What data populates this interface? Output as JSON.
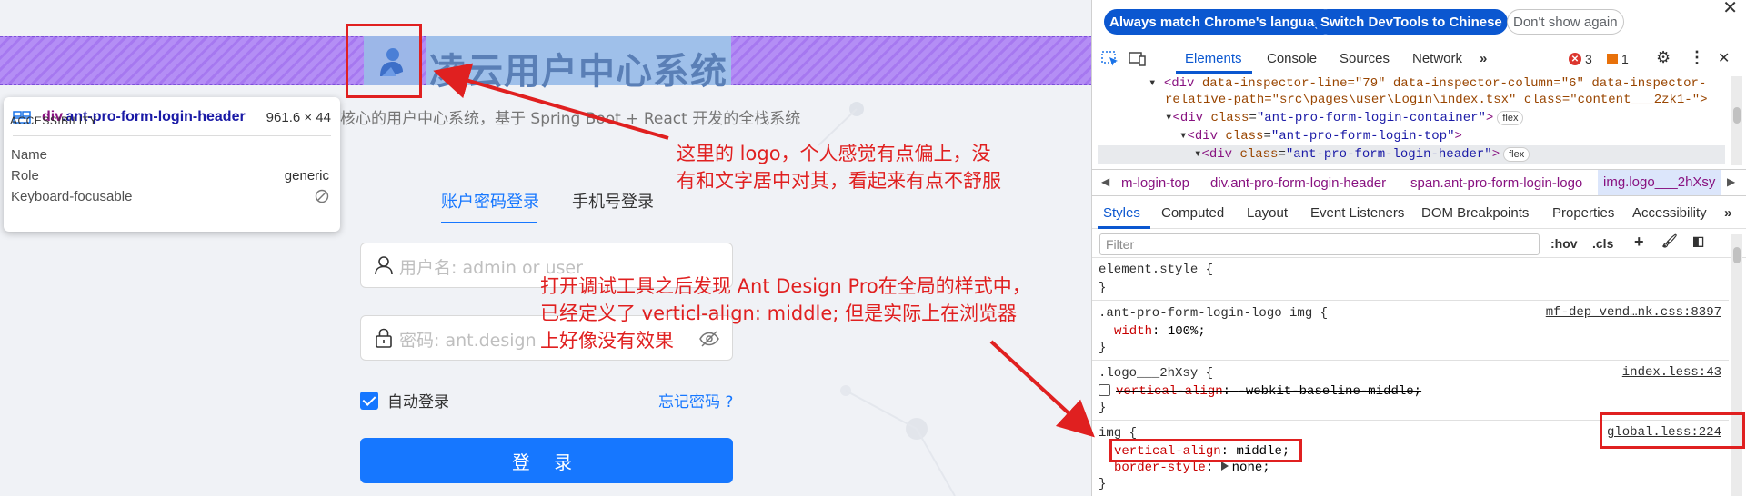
{
  "page": {
    "title": "凌云用户中心系统",
    "subtitle": "核心的用户中心系统，基于 Spring Boot + React 开发的全栈系统",
    "tabs": [
      "账户密码登录",
      "手机号登录"
    ],
    "username_placeholder": "用户名: admin or user",
    "password_placeholder": "密码: ant.design",
    "remember_label": "自动登录",
    "forgot_label": "忘记密码 ?",
    "login_label": "登 录"
  },
  "tooltip": {
    "tag": "div",
    "class": ".ant-pro-form-login-header",
    "size": "961.6 × 44",
    "section": "ACCESSIBILITY",
    "rows": [
      {
        "name": "Name",
        "value": ""
      },
      {
        "name": "Role",
        "value": "generic"
      },
      {
        "name": "Keyboard-focusable",
        "value": ""
      }
    ]
  },
  "annotations": {
    "note1": [
      "这里的 logo，个人感觉有点偏上，没",
      "有和文字居中对其，看起来有点不舒服"
    ],
    "note2": [
      "打开调试工具之后发现 Ant Design Pro在全局的样式中，",
      "已经定义了 verticl-align: middle; 但是实际上在浏览器",
      "上好像没有效果"
    ]
  },
  "devtools": {
    "lang_buttons": [
      "Always match Chrome's language",
      "Switch DevTools to Chinese",
      "Don't show again"
    ],
    "tabs": [
      "Elements",
      "Console",
      "Sources",
      "Network"
    ],
    "errors": "3",
    "warnings": "1",
    "dom": {
      "line1": {
        "tag": "<div",
        "attrs": "data-inspector-line=\"79\" data-inspector-column=\"6\" data-inspector-"
      },
      "line2": "relative-path=\"src\\pages\\user\\Login\\index.tsx\" class=\"content___2zk1-\">",
      "line3": {
        "open": "<div ",
        "attr": "class",
        "value": "\"ant-pro-form-login-container\"",
        "close": ">",
        "pill": "flex"
      },
      "line4": {
        "open": "<div ",
        "attr": "class",
        "value": "\"ant-pro-form-login-top\"",
        "close": ">"
      },
      "line5": {
        "open": "<div ",
        "attr": "class",
        "value": "\"ant-pro-form-login-header\"",
        "close": ">",
        "pill": "flex"
      }
    },
    "breadcrumbs": [
      "m-login-top",
      "div.ant-pro-form-login-header",
      "span.ant-pro-form-login-logo",
      "img.logo___2hXsy"
    ],
    "subtabs": [
      "Styles",
      "Computed",
      "Layout",
      "Event Listeners",
      "DOM Breakpoints",
      "Properties",
      "Accessibility"
    ],
    "filter_placeholder": "Filter",
    "filter_tools": [
      ":hov",
      ".cls"
    ],
    "rules": {
      "element_style": "element.style {",
      "r1_selector": ".ant-pro-form-login-logo img {",
      "r1_source": "mf-dep_vend…nk.css:8397",
      "r1_prop": "width",
      "r1_val": "100%;",
      "r2_selector": ".logo___2hXsy {",
      "r2_source": "index.less:43",
      "r2_prop": "vertical-align",
      "r2_val": "-webkit-baseline-middle;",
      "r3_selector": "img {",
      "r3_source": "global.less:224",
      "r3_prop": "vertical-align",
      "r3_val": "middle;",
      "r3_prop2": "border-style",
      "r3_val2": "none;",
      "close": "}"
    }
  }
}
